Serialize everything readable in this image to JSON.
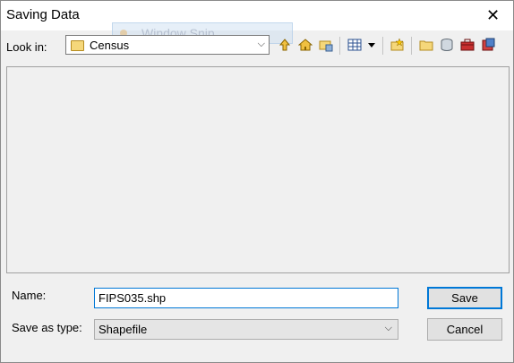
{
  "window": {
    "title": "Saving Data"
  },
  "ghost_label": "Window Snip",
  "look_in": {
    "label": "Look in:",
    "value": "Census"
  },
  "toolbar_icons": [
    "up-one-level-icon",
    "home-icon",
    "connect-folder-icon",
    "view-menu-icon",
    "new-folder-icon",
    "folder-icon",
    "database-icon",
    "toolbox-icon",
    "geodatabase-icon"
  ],
  "name": {
    "label": "Name:",
    "value": "FIPS035.shp"
  },
  "save_as_type": {
    "label": "Save as type:",
    "value": "Shapefile"
  },
  "buttons": {
    "save": "Save",
    "cancel": "Cancel"
  },
  "colors": {
    "accent": "#0078d7",
    "folder": "#f5d77a"
  }
}
